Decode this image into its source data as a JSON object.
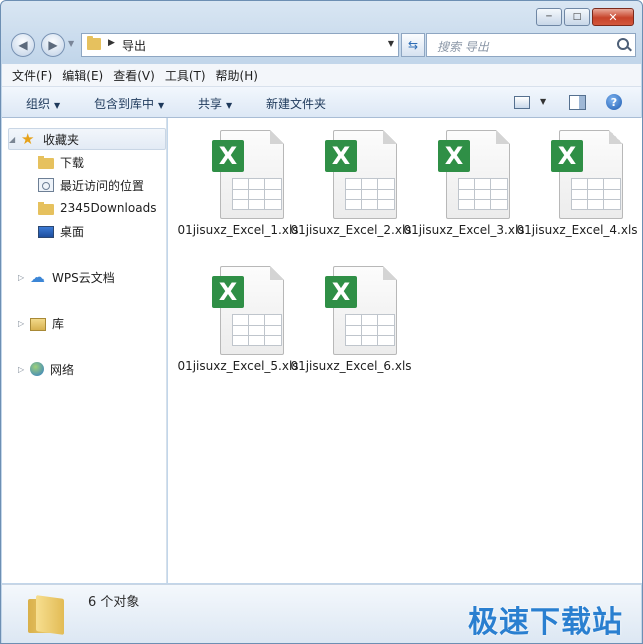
{
  "window": {
    "caption_buttons": [
      "─",
      "□",
      "✕"
    ]
  },
  "address": {
    "breadcrumb": "导出",
    "search_placeholder": "搜索 导出"
  },
  "menu": [
    "文件(F)",
    "编辑(E)",
    "查看(V)",
    "工具(T)",
    "帮助(H)"
  ],
  "toolbar": {
    "organize": "组织",
    "include": "包含到库中",
    "share": "共享",
    "new_folder": "新建文件夹"
  },
  "nav": {
    "favorites": "收藏夹",
    "downloads": "下载",
    "recent": "最近访问的位置",
    "downloads2345": "2345Downloads",
    "desktop": "桌面",
    "wps": "WPS云文档",
    "libraries": "库",
    "network": "网络"
  },
  "files": [
    "01jisuxz_Excel_1.xls",
    "01jisuxz_Excel_2.xls",
    "01jisuxz_Excel_3.xls",
    "01jisuxz_Excel_4.xls",
    "01jisuxz_Excel_5.xls",
    "01jisuxz_Excel_6.xls"
  ],
  "file_badge": "X",
  "status": {
    "count": "6 个对象"
  },
  "watermark": "极速下载站",
  "colors": {
    "excel_green": "#2f8f46",
    "watermark_blue": "#2a7fd0"
  }
}
